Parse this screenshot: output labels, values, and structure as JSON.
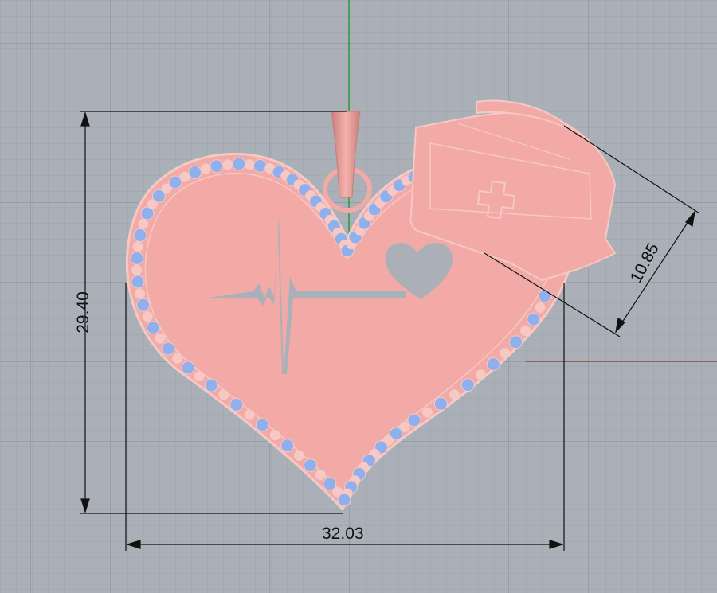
{
  "viewport": {
    "background": "#a9b0b8",
    "grid_minor_color": "#9ba3ab",
    "grid_major_color": "#8a939c",
    "axis_y_color": "#2e9b3a",
    "axis_x_color": "#9a3a32"
  },
  "model": {
    "body_color": "#f2aaa6",
    "edge_color": "#f7c8c4",
    "stone_color": "#8fb0ec",
    "bail_color": "#e3938e"
  },
  "dimensions": {
    "height": "29.40",
    "width": "32.03",
    "cap": "10.85"
  }
}
